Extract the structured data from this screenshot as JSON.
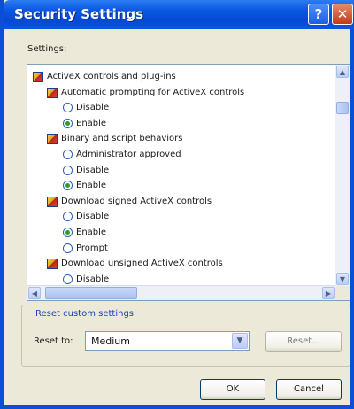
{
  "window": {
    "title": "Security Settings"
  },
  "titlebar": {
    "help_label": "?",
    "close_label": "✕"
  },
  "settings": {
    "label": "Settings:",
    "items": [
      {
        "type": "category",
        "label": "ActiveX controls and plug-ins"
      },
      {
        "type": "setting",
        "label": "Automatic prompting for ActiveX controls"
      },
      {
        "type": "option",
        "label": "Disable",
        "selected": false
      },
      {
        "type": "option",
        "label": "Enable",
        "selected": true
      },
      {
        "type": "setting",
        "label": "Binary and script behaviors"
      },
      {
        "type": "option",
        "label": "Administrator approved",
        "selected": false
      },
      {
        "type": "option",
        "label": "Disable",
        "selected": false
      },
      {
        "type": "option",
        "label": "Enable",
        "selected": true
      },
      {
        "type": "setting",
        "label": "Download signed ActiveX controls"
      },
      {
        "type": "option",
        "label": "Disable",
        "selected": false
      },
      {
        "type": "option",
        "label": "Enable",
        "selected": true
      },
      {
        "type": "option",
        "label": "Prompt",
        "selected": false
      },
      {
        "type": "setting",
        "label": "Download unsigned ActiveX controls"
      },
      {
        "type": "option",
        "label": "Disable",
        "selected": false
      }
    ]
  },
  "scrollbar": {
    "up": "▲",
    "down": "▼",
    "left": "◀",
    "right": "▶"
  },
  "reset": {
    "group_title": "Reset custom settings",
    "reset_to_label": "Reset to:",
    "selected_value": "Medium",
    "dropdown_arrow": "▼",
    "reset_button": "Reset..."
  },
  "footer": {
    "ok": "OK",
    "cancel": "Cancel"
  },
  "colors": {
    "title_bar": "#0a58e2",
    "dialog_bg": "#ece9d8",
    "group_title": "#1c3fb8"
  }
}
